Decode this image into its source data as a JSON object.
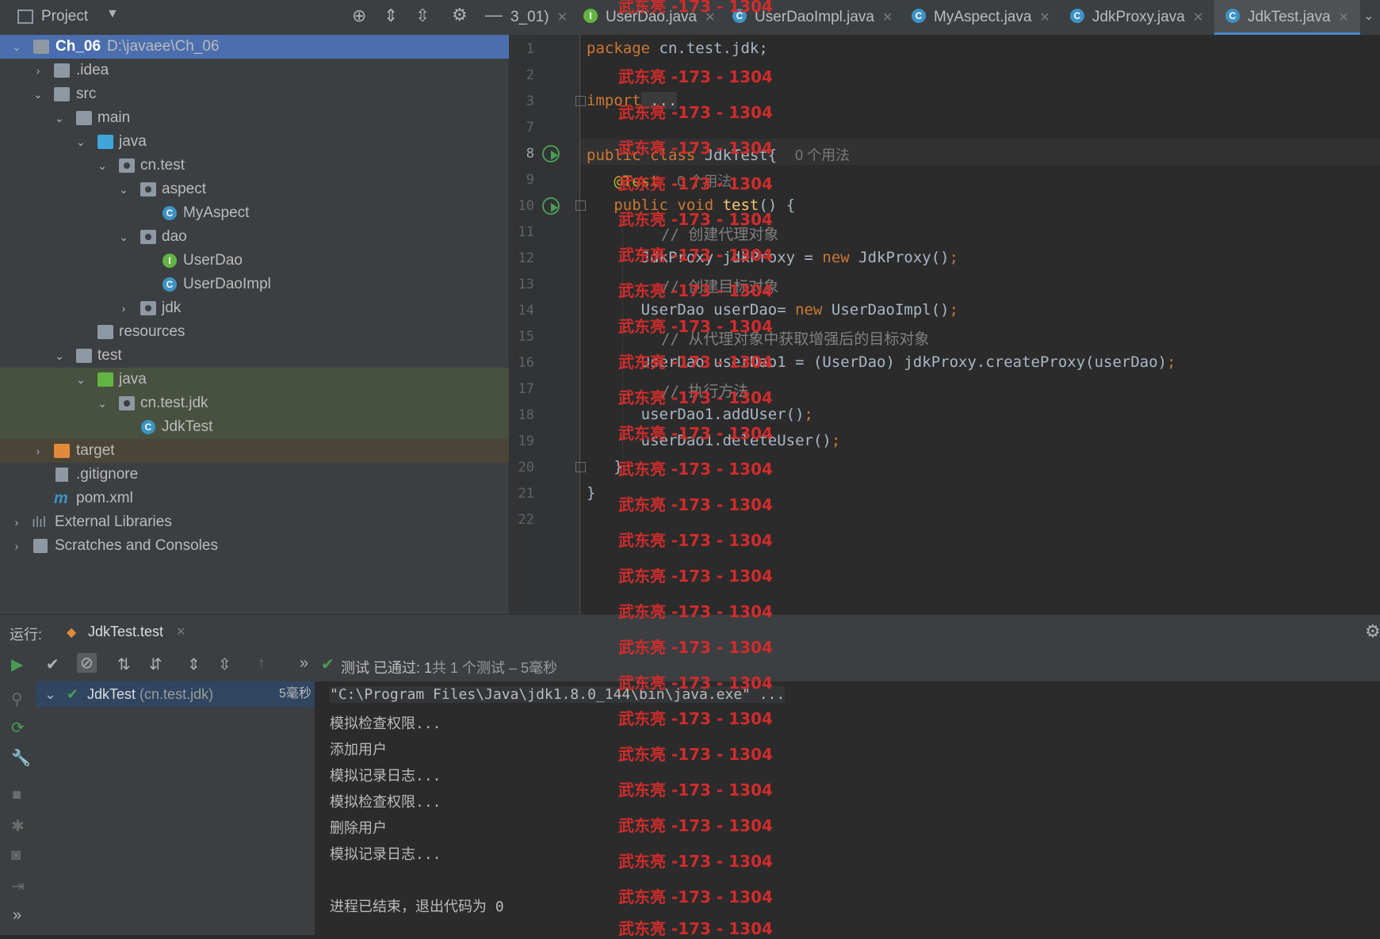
{
  "project_panel": {
    "title": "Project",
    "tree": [
      {
        "label": "Ch_06",
        "path": "D:\\javaee\\Ch_06"
      },
      {
        "label": ".idea"
      },
      {
        "label": "src"
      },
      {
        "label": "main"
      },
      {
        "label": "java"
      },
      {
        "label": "cn.test"
      },
      {
        "label": "aspect"
      },
      {
        "label": "MyAspect"
      },
      {
        "label": "dao"
      },
      {
        "label": "UserDao"
      },
      {
        "label": "UserDaoImpl"
      },
      {
        "label": "jdk"
      },
      {
        "label": "resources"
      },
      {
        "label": "test"
      },
      {
        "label": "java"
      },
      {
        "label": "cn.test.jdk"
      },
      {
        "label": "JdkTest"
      },
      {
        "label": "target"
      },
      {
        "label": ".gitignore"
      },
      {
        "label": "pom.xml"
      },
      {
        "label": "External Libraries"
      },
      {
        "label": "Scratches and Consoles"
      }
    ]
  },
  "tabs": [
    {
      "label": "3_01)"
    },
    {
      "label": "UserDao.java",
      "icon": "I"
    },
    {
      "label": "UserDaoImpl.java",
      "icon": "C"
    },
    {
      "label": "MyAspect.java",
      "icon": "C"
    },
    {
      "label": "JdkProxy.java",
      "icon": "C"
    },
    {
      "label": "JdkTest.java",
      "icon": "C"
    }
  ],
  "editor": {
    "line_numbers": [
      "1",
      "2",
      "3",
      "7",
      "8",
      "9",
      "10",
      "11",
      "12",
      "13",
      "14",
      "15",
      "16",
      "17",
      "18",
      "19",
      "20",
      "21",
      "22"
    ],
    "lines": {
      "l1_kw": "package",
      "l1_rest": " cn.test.jdk;",
      "l3_kw": "import",
      "l3_fold": " ...",
      "l8_kw": "public class",
      "l8_rest": " JdkTest{",
      "l8_hint": "0 个用法",
      "l9_ann": "@Test",
      "l9_hint": "0 个用法",
      "l10_kw": "public void",
      "l10_fn": " test",
      "l10_rest": "() {",
      "l11": "// 创建代理对象",
      "l12_a": "JdkProxy jdkProxy = ",
      "l12_kw": "new",
      "l12_b": " JdkProxy()",
      "l12_semi": ";",
      "l13": "// 创建目标对象",
      "l14_a": "UserDao userDao= ",
      "l14_kw": "new",
      "l14_b": " UserDaoImpl()",
      "l14_semi": ";",
      "l15": "// 从代理对象中获取增强后的目标对象",
      "l16_a": "UserDao userDao1 = (UserDao) jdkProxy.createProxy(userDao)",
      "l16_semi": ";",
      "l17": "// 执行方法",
      "l18_a": "userDao1.addUser()",
      "l18_semi": ";",
      "l19_a": "userDao1.deleteUser()",
      "l19_semi": ";",
      "l20": "}",
      "l21": "}"
    }
  },
  "run_panel": {
    "label": "运行:",
    "tab": "JdkTest.test",
    "status_prefix": "测试 已通过:",
    "status_count": "1",
    "status_detail": "共 1 个测试 – 5毫秒",
    "test_node": "JdkTest",
    "test_pkg": "(cn.test.jdk)",
    "test_time": "5毫秒",
    "console_lines": [
      "\"C:\\Program Files\\Java\\jdk1.8.0_144\\bin\\java.exe\" ...",
      "模拟检查权限...",
      "添加用户",
      "模拟记录日志...",
      "模拟检查权限...",
      "删除用户",
      "模拟记录日志...",
      "",
      "进程已结束，退出代码为 0"
    ]
  },
  "watermark": "武东亮 -173 - 1304",
  "colors": {
    "accent": "#4b6eaf",
    "keyword": "#cc7832",
    "annotation": "#bbb529",
    "function": "#ffc66d",
    "comment": "#808080",
    "watermark": "#d12c2c",
    "pass": "#499c54"
  }
}
